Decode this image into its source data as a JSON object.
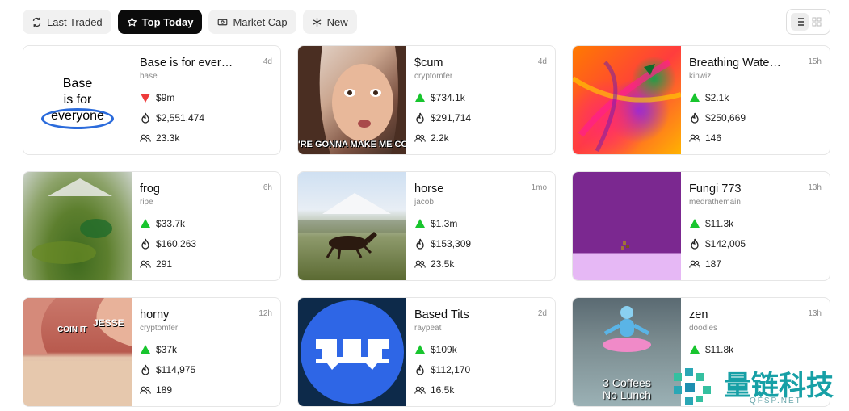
{
  "tabs": [
    {
      "label": "Last Traded",
      "icon": "refresh-icon",
      "active": false
    },
    {
      "label": "Top Today",
      "icon": "star-icon",
      "active": true
    },
    {
      "label": "Market Cap",
      "icon": "cash-icon",
      "active": false
    },
    {
      "label": "New",
      "icon": "asterisk-icon",
      "active": false
    }
  ],
  "view_toggle": {
    "list_active": true
  },
  "colors": {
    "up": "#18c52e",
    "down": "#ee3b3b",
    "active_tab": "#0b0b0b"
  },
  "cards": [
    {
      "name": "Base is for everyone",
      "author": "base",
      "age": "4d",
      "change": "$9m",
      "direction": "down",
      "volume": "$2,551,474",
      "holders": "23.3k",
      "thumb": {
        "line1": "Base",
        "line2": "is for",
        "line3": "everyone"
      }
    },
    {
      "name": "$cum",
      "author": "cryptomfer",
      "age": "4d",
      "change": "$734.1k",
      "direction": "up",
      "volume": "$291,714",
      "holders": "2.2k",
      "thumb": {
        "caption": "'RE GONNA MAKE ME COI"
      }
    },
    {
      "name": "Breathing Watercol...",
      "author": "kinwiz",
      "age": "15h",
      "change": "$2.1k",
      "direction": "up",
      "volume": "$250,669",
      "holders": "146"
    },
    {
      "name": "frog",
      "author": "ripe",
      "age": "6h",
      "change": "$33.7k",
      "direction": "up",
      "volume": "$160,263",
      "holders": "291"
    },
    {
      "name": "horse",
      "author": "jacob",
      "age": "1mo",
      "change": "$1.3m",
      "direction": "up",
      "volume": "$153,309",
      "holders": "23.5k"
    },
    {
      "name": "Fungi 773",
      "author": "medrathemain",
      "age": "13h",
      "change": "$11.3k",
      "direction": "up",
      "volume": "$142,005",
      "holders": "187"
    },
    {
      "name": "horny",
      "author": "cryptomfer",
      "age": "12h",
      "change": "$37k",
      "direction": "up",
      "volume": "$114,975",
      "holders": "189",
      "thumb": {
        "label1": "COIN IT",
        "label2": "JESSE"
      }
    },
    {
      "name": "Based Tits",
      "author": "raypeat",
      "age": "2d",
      "change": "$109k",
      "direction": "up",
      "volume": "$112,170",
      "holders": "16.5k"
    },
    {
      "name": "zen",
      "author": "doodles",
      "age": "13h",
      "change": "$11.8k",
      "direction": "up",
      "volume": "",
      "holders": "",
      "thumb": {
        "line1": "3 Coffees",
        "line2": "No Lunch"
      }
    }
  ],
  "watermark": {
    "text": "量链科技",
    "sub": "QFSP.NET"
  }
}
